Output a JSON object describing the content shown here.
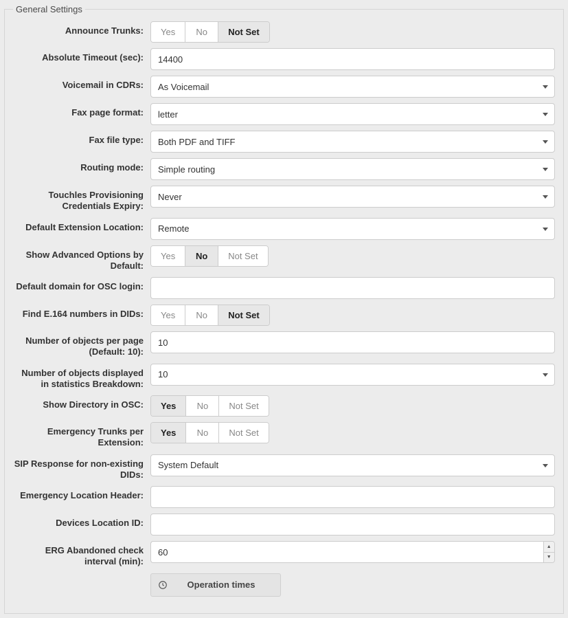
{
  "fieldset_title": "General Settings",
  "toggle_options": {
    "yes": "Yes",
    "no": "No",
    "notset": "Not Set"
  },
  "announce_trunks": {
    "label": "Announce Trunks:",
    "selected": "notset"
  },
  "absolute_timeout": {
    "label": "Absolute Timeout (sec):",
    "value": "14400"
  },
  "voicemail_cdrs": {
    "label": "Voicemail in CDRs:",
    "value": "As Voicemail"
  },
  "fax_page_format": {
    "label": "Fax page format:",
    "value": "letter"
  },
  "fax_file_type": {
    "label": "Fax file type:",
    "value": "Both PDF and TIFF"
  },
  "routing_mode": {
    "label": "Routing mode:",
    "value": "Simple routing"
  },
  "touchless_prov": {
    "label": "Touchles Provisioning Credentials Expiry:",
    "value": "Never"
  },
  "default_ext_location": {
    "label": "Default Extension Location:",
    "value": "Remote"
  },
  "show_advanced": {
    "label": "Show Advanced Options by Default:",
    "selected": "no"
  },
  "default_domain_osc": {
    "label": "Default domain for OSC login:",
    "value": ""
  },
  "find_e164": {
    "label": "Find E.164 numbers in DIDs:",
    "selected": "notset"
  },
  "objects_per_page": {
    "label": "Number of objects per page (Default: 10):",
    "value": "10"
  },
  "objects_stats": {
    "label": "Number of objects displayed in statistics Breakdown:",
    "value": "10"
  },
  "show_directory_osc": {
    "label": "Show Directory in OSC:",
    "selected": "yes"
  },
  "emergency_trunks": {
    "label": "Emergency Trunks per Extension:",
    "selected": "yes"
  },
  "sip_response": {
    "label": "SIP Response for non-existing DIDs:",
    "value": "System Default"
  },
  "emergency_location_hdr": {
    "label": "Emergency Location Header:",
    "value": ""
  },
  "devices_location_id": {
    "label": "Devices Location ID:",
    "value": ""
  },
  "erg_abandoned": {
    "label": "ERG Abandoned check interval (min):",
    "value": "60"
  },
  "operation_times": {
    "label": "Operation times"
  }
}
